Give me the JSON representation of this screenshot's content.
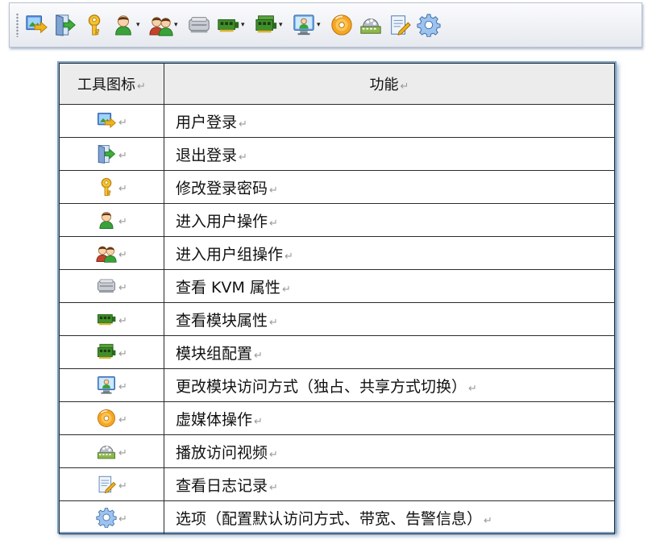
{
  "toolbar": {
    "buttons": [
      {
        "icon": "login-icon",
        "dropdown": false
      },
      {
        "icon": "logout-door-icon",
        "dropdown": false
      },
      {
        "icon": "key-icon",
        "dropdown": false
      },
      {
        "icon": "user-icon",
        "dropdown": true
      },
      {
        "icon": "user-group-icon",
        "dropdown": true
      },
      {
        "icon": "kvm-device-icon",
        "dropdown": false
      },
      {
        "icon": "module-icon",
        "dropdown": true
      },
      {
        "icon": "module-group-icon",
        "dropdown": true
      },
      {
        "icon": "access-mode-icon",
        "dropdown": true
      },
      {
        "icon": "virtual-media-disc-icon",
        "dropdown": false
      },
      {
        "icon": "video-playback-icon",
        "dropdown": false
      },
      {
        "icon": "log-notepad-icon",
        "dropdown": false
      },
      {
        "icon": "settings-gear-icon",
        "dropdown": false
      }
    ],
    "dropdown_arrow": "▾"
  },
  "table": {
    "header": {
      "icon_col": "工具图标",
      "function_col": "功能"
    },
    "paragraph_mark": "↵",
    "rows": [
      {
        "icon": "login-icon",
        "function": "用户登录"
      },
      {
        "icon": "logout-door-icon",
        "function": "退出登录"
      },
      {
        "icon": "key-icon",
        "function": "修改登录密码"
      },
      {
        "icon": "user-icon",
        "function": "进入用户操作"
      },
      {
        "icon": "user-group-icon",
        "function": "进入用户组操作"
      },
      {
        "icon": "kvm-device-icon",
        "function": "查看 KVM 属性"
      },
      {
        "icon": "module-icon",
        "function": "查看模块属性"
      },
      {
        "icon": "module-group-icon",
        "function": "模块组配置"
      },
      {
        "icon": "access-mode-icon",
        "function": "更改模块访问方式（独占、共享方式切换）"
      },
      {
        "icon": "virtual-media-disc-icon",
        "function": "虚媒体操作"
      },
      {
        "icon": "video-playback-icon",
        "function": "播放访问视频"
      },
      {
        "icon": "log-notepad-icon",
        "function": "查看日志记录"
      },
      {
        "icon": "settings-gear-icon",
        "function": "选项（配置默认访问方式、带宽、告警信息）"
      }
    ]
  }
}
